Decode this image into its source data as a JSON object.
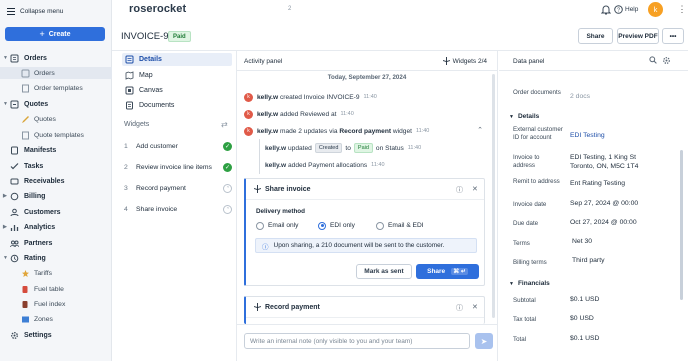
{
  "sidebar": {
    "collapse_label": "Collapse menu",
    "create_label": "Create",
    "items": [
      {
        "label": "Orders",
        "icon": "orders-icon",
        "type": "parent"
      },
      {
        "label": "Orders",
        "icon": "orders-icon",
        "type": "child"
      },
      {
        "label": "Order templates",
        "icon": "template-icon",
        "type": "child"
      },
      {
        "label": "Quotes",
        "icon": "quotes-icon",
        "type": "parent"
      },
      {
        "label": "Quotes",
        "icon": "quotes-icon",
        "type": "child"
      },
      {
        "label": "Quote templates",
        "icon": "template-icon",
        "type": "child"
      },
      {
        "label": "Manifests",
        "icon": "manifest-icon",
        "type": "parent"
      },
      {
        "label": "Tasks",
        "icon": "tasks-icon",
        "type": "parent"
      },
      {
        "label": "Receivables",
        "icon": "receivables-icon",
        "type": "parent"
      },
      {
        "label": "Billing",
        "icon": "billing-icon",
        "type": "parent"
      },
      {
        "label": "Customers",
        "icon": "customers-icon",
        "type": "parent"
      },
      {
        "label": "Analytics",
        "icon": "analytics-icon",
        "type": "parent"
      },
      {
        "label": "Partners",
        "icon": "partners-icon",
        "type": "parent"
      },
      {
        "label": "Rating",
        "icon": "rating-icon",
        "type": "parent"
      },
      {
        "label": "Tariffs",
        "icon": "tariffs-icon",
        "type": "child"
      },
      {
        "label": "Fuel table",
        "icon": "fuel-table-icon",
        "type": "child"
      },
      {
        "label": "Fuel index",
        "icon": "fuel-index-icon",
        "type": "child"
      },
      {
        "label": "Zones",
        "icon": "zones-icon",
        "type": "child"
      },
      {
        "label": "Settings",
        "icon": "settings-icon",
        "type": "parent"
      }
    ]
  },
  "topbar": {
    "logo": "roserocket",
    "version": "2",
    "help_label": "Help",
    "avatar_letter": "k"
  },
  "invoice": {
    "title": "INVOICE-9",
    "status": "Paid",
    "share_label": "Share",
    "preview_label": "Preview PDF",
    "more_label": "•••"
  },
  "leftnav": {
    "tabs": [
      "Details",
      "Map",
      "Canvas",
      "Documents"
    ],
    "widgets_title": "Widgets",
    "widgets": [
      {
        "num": "1",
        "label": "Add customer",
        "done": true
      },
      {
        "num": "2",
        "label": "Review invoice line items",
        "done": true
      },
      {
        "num": "3",
        "label": "Record payment",
        "done": false
      },
      {
        "num": "4",
        "label": "Share invoice",
        "done": false
      }
    ]
  },
  "activity": {
    "title": "Activity panel",
    "widgets_count": "Widgets 2/4",
    "date": "Today, September 27, 2024",
    "e1_user": "kelly.w",
    "e1_text": "created Invoice INVOICE-9",
    "e1_time": "11:40",
    "e2_user": "kelly.w",
    "e2_text": "added Reviewed at",
    "e2_time": "11:40",
    "e3_user": "kelly.w",
    "e3_text1": "made 2 updates via",
    "e3_bold": "Record payment",
    "e3_text2": "widget",
    "e3_time": "11:40",
    "s1_user": "kelly.w",
    "s1_text1": "updated",
    "s1_tag1": "Created",
    "s1_to": "to",
    "s1_tag2": "Paid",
    "s1_text2": "on Status",
    "s1_time": "11:40",
    "s2_user": "kelly.w",
    "s2_text": "added Payment allocations",
    "s2_time": "11:40",
    "share_card": {
      "title": "Share invoice",
      "method_label": "Delivery method",
      "options": [
        "Email only",
        "EDI only",
        "Email & EDI"
      ],
      "selected": "EDI only",
      "info": "Upon sharing, a 210 document will be sent to the customer.",
      "mark_sent_label": "Mark as sent",
      "share_label": "Share",
      "share_kbd": "⌘ ↵"
    },
    "record_card": {
      "title": "Record payment"
    },
    "note_placeholder": "Write an internal note (only visible to you and your team)"
  },
  "datapanel": {
    "title": "Data panel",
    "order_docs_label": "Order documents",
    "order_docs_value": "2 docs",
    "details_title": "Details",
    "rows": [
      {
        "label": "External customer ID for account",
        "value": "EDI Testing"
      },
      {
        "label": "Invoice to address",
        "value": "EDI Testing, 1 King St",
        "value2": "Toronto, ON, M5C 1T4"
      },
      {
        "label": "Remit to address",
        "value": "Ent Rating Testing"
      },
      {
        "label": "Invoice date",
        "value": "Sep 27, 2024 @ 00:00"
      },
      {
        "label": "Due date",
        "value": "Oct 27, 2024 @ 00:00"
      },
      {
        "label": "Terms",
        "value": "Net 30"
      },
      {
        "label": "Billing terms",
        "value": "Third party"
      }
    ],
    "financials_title": "Financials",
    "fin_rows": [
      {
        "label": "Subtotal",
        "value": "$0.1 USD"
      },
      {
        "label": "Tax total",
        "value": "$0 USD"
      },
      {
        "label": "Total",
        "value": "$0.1 USD"
      }
    ]
  },
  "colors": {
    "accent": "#2f6fdc",
    "paid_green": "#1e7a35",
    "avatar": "#f7a023",
    "activity_dot": "#e05a48"
  }
}
